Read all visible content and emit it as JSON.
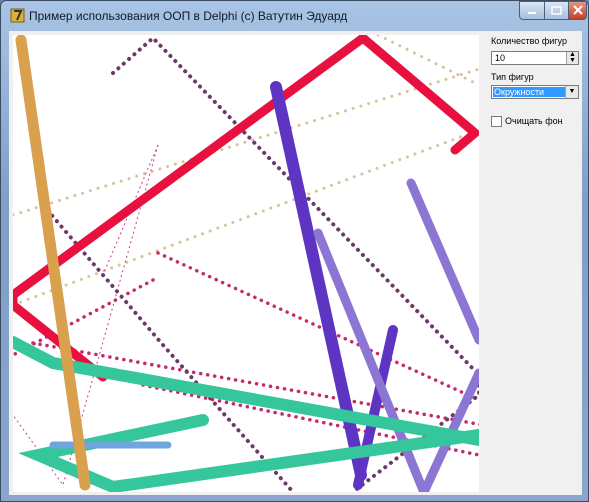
{
  "window": {
    "title": "Пример использования ООП в Delphi (c) Ватутин Эдуард",
    "controls": {
      "minimize": "–",
      "maximize": "□",
      "close": "×"
    }
  },
  "panel": {
    "count_label": "Количество фигур",
    "count_value": "10",
    "type_label": "Тип фигур",
    "type_value": "Окружности",
    "clear_label": "Очищать фон",
    "clear_checked": false
  },
  "colors": {
    "red": "#e8103f",
    "violet_dark": "#5e34c2",
    "violet_light": "#8c76d4",
    "tan": "#d9a04e",
    "teal": "#35c79b",
    "plum": "#6b3a6a",
    "raspberry": "#c62a6a",
    "beige": "#d8c49a",
    "blue": "#6fa6e0"
  }
}
